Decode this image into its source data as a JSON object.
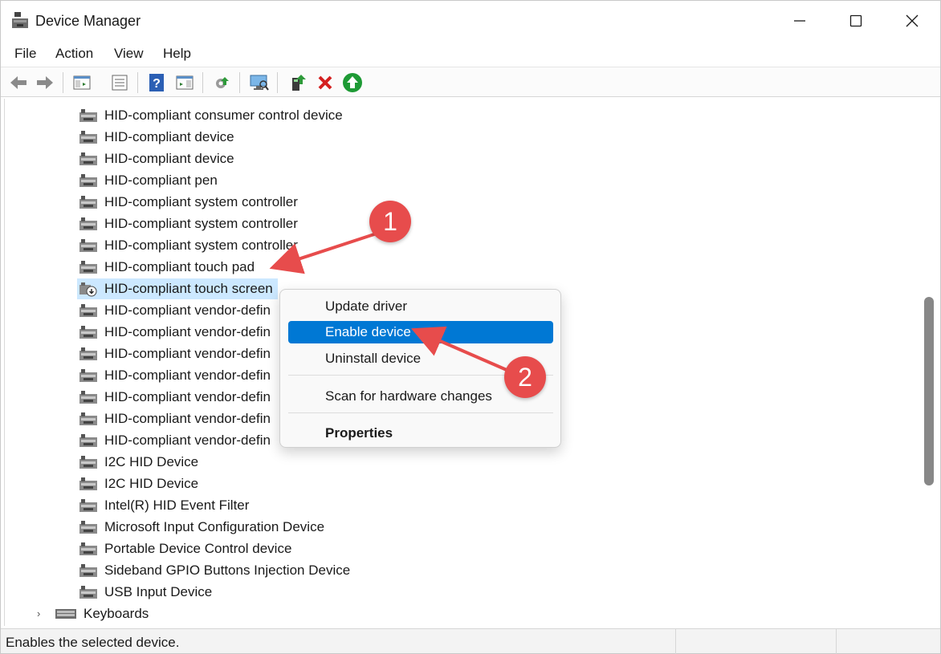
{
  "window": {
    "title": "Device Manager",
    "icon": "device-manager-icon"
  },
  "menu": [
    "File",
    "Action",
    "View",
    "Help"
  ],
  "toolbar": {
    "buttons": [
      "back-arrow-icon",
      "forward-arrow-icon",
      "show-hide-console-tree-icon",
      "properties-icon",
      "help-icon",
      "show-action-pane-icon",
      "update-driver-icon",
      "scan-hardware-icon",
      "enable-device-icon",
      "uninstall-device-icon",
      "enable-green-arrow-icon"
    ]
  },
  "tree": {
    "children": [
      "HID-compliant consumer control device",
      "HID-compliant device",
      "HID-compliant device",
      "HID-compliant pen",
      "HID-compliant system controller",
      "HID-compliant system controller",
      "HID-compliant system controller",
      "HID-compliant touch pad",
      "HID-compliant touch screen",
      "HID-compliant vendor-defin",
      "HID-compliant vendor-defin",
      "HID-compliant vendor-defin",
      "HID-compliant vendor-defin",
      "HID-compliant vendor-defin",
      "HID-compliant vendor-defin",
      "HID-compliant vendor-defin",
      "I2C HID Device",
      "I2C HID Device",
      "Intel(R) HID Event Filter",
      "Microsoft Input Configuration Device",
      "Portable Device Control device",
      "Sideband GPIO Buttons Injection Device",
      "USB Input Device"
    ],
    "selected_index": 8,
    "category": "Keyboards"
  },
  "context_menu": {
    "items": [
      "Update driver",
      "Enable device",
      "Uninstall device",
      "Scan for hardware changes",
      "Properties"
    ],
    "highlighted": "Enable device",
    "bold": "Properties"
  },
  "annotations": [
    "1",
    "2"
  ],
  "status": {
    "text": "Enables the selected device."
  },
  "colors": {
    "selection": "#cce8ff",
    "menu_highlight": "#0078d4",
    "callout": "#e74c4c"
  }
}
